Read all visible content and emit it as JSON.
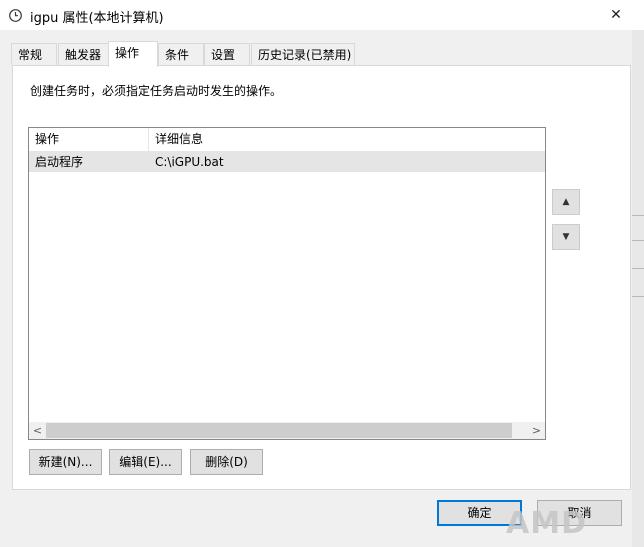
{
  "window": {
    "title": "igpu 属性(本地计算机)",
    "close_glyph": "✕"
  },
  "tabs": [
    {
      "label": "常规",
      "active": false
    },
    {
      "label": "触发器",
      "active": false
    },
    {
      "label": "操作",
      "active": true
    },
    {
      "label": "条件",
      "active": false
    },
    {
      "label": "设置",
      "active": false
    },
    {
      "label": "历史记录(已禁用)",
      "active": false
    }
  ],
  "actions_tab": {
    "description": "创建任务时，必须指定任务启动时发生的操作。",
    "columns": [
      "操作",
      "详细信息"
    ],
    "rows": [
      {
        "action": "启动程序",
        "details": "C:\\iGPU.bat"
      }
    ],
    "move_up_glyph": "▲",
    "move_down_glyph": "▼",
    "scroll_left_glyph": "<",
    "scroll_right_glyph": ">",
    "new_button": "新建(N)...",
    "edit_button": "编辑(E)...",
    "delete_button": "删除(D)"
  },
  "footer": {
    "ok_button": "确定",
    "cancel_button": "取消"
  },
  "watermark": "AMD",
  "colors": {
    "default_button_border": "#0078d7",
    "selection": "#e5e5e5",
    "accent_gray": "#f0f0f0"
  }
}
